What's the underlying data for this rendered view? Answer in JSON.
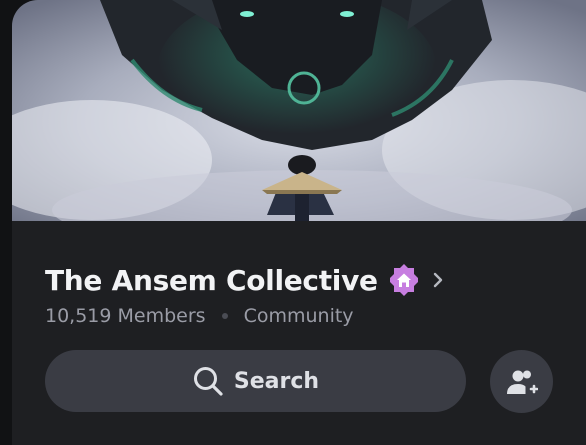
{
  "server": {
    "name": "The Ansem Collective",
    "members": "10,519 Members",
    "category": "Community",
    "badge_icon": "community-home-badge-icon",
    "badge_color": "#c77ee0"
  },
  "actions": {
    "search_label": "Search",
    "search_icon": "search-icon",
    "invite_icon": "add-user-icon"
  },
  "colors": {
    "background": "#1e1f22",
    "button": "#3a3c44",
    "title": "#f2f3f5",
    "subtext": "#9a9ca6"
  }
}
